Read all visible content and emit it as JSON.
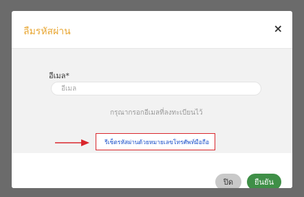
{
  "modal": {
    "title": "ลืมรหัสผ่าน",
    "close_symbol": "×",
    "email_label": "อีเมล*",
    "email_placeholder": "อีเมล",
    "email_value": "",
    "helper_text": "กรุณากรอกอีเมลที่ลงทะเบียนไว้",
    "sms_link_text": "รีเซ็ตรหัสผ่านด้วยหมายเลขโทรศัพท์มือถือ",
    "cancel_label": "ปิด",
    "confirm_label": "ยืนยัน"
  },
  "colors": {
    "title": "#e8a735",
    "highlight_box": "#d9262c",
    "link": "#1a4fc9",
    "confirm_button": "#3f8f47",
    "cancel_button": "#c9c9c9",
    "overlay": "#6b6b6b"
  },
  "icons": {
    "close": "close-icon",
    "arrow": "right-arrow-icon"
  }
}
